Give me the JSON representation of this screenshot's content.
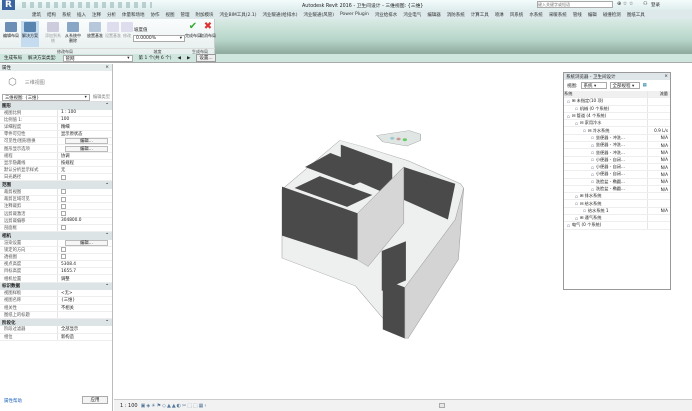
{
  "app": {
    "title": "Autodesk Revit 2016 -   卫生间设计 - 三维视图: {三维}",
    "search_placeholder": "键入关键字或短语",
    "user": "登录"
  },
  "tabs": [
    "建筑",
    "结构",
    "系统",
    "插入",
    "注释",
    "分析",
    "体量和场地",
    "协作",
    "视图",
    "管理",
    "附加模块",
    "鸿业BIM工具(2.1)",
    "鸿业暖通(给排水)",
    "鸿业暖通(风管)",
    "Power Plugin",
    "鸿业给排水",
    "鸿业电气",
    "编辑器",
    "消防系统",
    "计算工具",
    "喷淋",
    "风系统",
    "水系统",
    "采暖系统",
    "管线",
    "编辑",
    "碰撞检测",
    "图纸工具"
  ],
  "ribbon": {
    "buttons": [
      "编辑布局",
      "解决方案",
      "添加到系统",
      "从系统中删除",
      "放置基准",
      "设置基准",
      "修改",
      "修改"
    ],
    "slope_label": "坡度值",
    "slope_value": "0.0000%",
    "finish": "完成布局",
    "cancel": "取消布局",
    "panels": [
      "修改布局",
      "坡度",
      "生成布局"
    ]
  },
  "optbar": {
    "mode": "生成布局",
    "type_label": "解决方案类型:",
    "type_value": "管网",
    "counter": "第 1 个(共 6 个)",
    "prev": "◀",
    "next": "▶",
    "settings": "设置..."
  },
  "props": {
    "title": "属性",
    "type_name": "三维视图",
    "view_selector": "三维视图: {三维}",
    "edit_type": "编辑类型",
    "sections": [
      {
        "name": "图形",
        "rows": [
          [
            "视图比例",
            "1 : 100"
          ],
          [
            "比例值 1:",
            "100"
          ],
          [
            "详细程度",
            "精细"
          ],
          [
            "零件可见性",
            "显示原状态"
          ],
          [
            "可见性/图形替换",
            "编辑..."
          ],
          [
            "图形显示选项",
            "编辑..."
          ],
          [
            "规程",
            "协调"
          ],
          [
            "显示隐藏线",
            "按规程"
          ],
          [
            "默认分析显示样式",
            "无"
          ],
          [
            "日光路径",
            "☐"
          ]
        ]
      },
      {
        "name": "范围",
        "rows": [
          [
            "裁剪视图",
            "☐"
          ],
          [
            "裁剪区域可见",
            "☐"
          ],
          [
            "注释裁剪",
            "☐"
          ],
          [
            "远剪裁激活",
            "☐"
          ],
          [
            "远剪裁偏移",
            "304800.0"
          ],
          [
            "剖面框",
            "☐"
          ]
        ]
      },
      {
        "name": "相机",
        "rows": [
          [
            "渲染设置",
            "编辑..."
          ],
          [
            "锁定的方向",
            "☐"
          ],
          [
            "透视图",
            "☐"
          ],
          [
            "视点高度",
            "5308.4"
          ],
          [
            "目标高度",
            "1655.7"
          ],
          [
            "相机位置",
            "调整"
          ]
        ]
      },
      {
        "name": "标识数据",
        "rows": [
          [
            "视图样板",
            "<无>"
          ],
          [
            "视图名称",
            "{三维}"
          ],
          [
            "相关性",
            "不相关"
          ],
          [
            "图纸上的标题",
            ""
          ]
        ]
      },
      {
        "name": "阶段化",
        "rows": [
          [
            "阶段过滤器",
            "全部显示"
          ],
          [
            "相位",
            "新构造"
          ]
        ]
      }
    ],
    "help": "属性帮助",
    "apply": "应用"
  },
  "sysbrowser": {
    "title": "系统浏览器 - 卫生间设计",
    "view_label": "视图:",
    "view_value": "系统",
    "discipline_value": "全部规程",
    "col_system": "系统",
    "col_flow": "流量",
    "rows": [
      {
        "label": "⊞ 未指定(10 项)",
        "flow": "",
        "lvl": 0
      },
      {
        "label": "机械 (0 个系统)",
        "flow": "",
        "lvl": 1
      },
      {
        "label": "⊟ 管道 (4 个系统)",
        "flow": "",
        "lvl": 0
      },
      {
        "label": "⊟ 家用冷水",
        "flow": "",
        "lvl": 1
      },
      {
        "label": "⊟ 冷水系统",
        "flow": "0.9 L/s",
        "lvl": 2
      },
      {
        "label": "坐便器 - 冲洗...",
        "flow": "N/A",
        "lvl": 3
      },
      {
        "label": "坐便器 - 冲洗...",
        "flow": "N/A",
        "lvl": 3
      },
      {
        "label": "坐便器 - 冲洗...",
        "flow": "N/A",
        "lvl": 3
      },
      {
        "label": "小便器 - 自闭...",
        "flow": "N/A",
        "lvl": 3
      },
      {
        "label": "小便器 - 自闭...",
        "flow": "N/A",
        "lvl": 3
      },
      {
        "label": "小便器 - 自闭...",
        "flow": "N/A",
        "lvl": 3
      },
      {
        "label": "洗脸盆 - 椭圆...",
        "flow": "N/A",
        "lvl": 3
      },
      {
        "label": "洗脸盆 - 椭圆...",
        "flow": "N/A",
        "lvl": 3
      },
      {
        "label": "⊞ 排水系统",
        "flow": "",
        "lvl": 1
      },
      {
        "label": "⊟ 给水系统",
        "flow": "",
        "lvl": 1
      },
      {
        "label": "给水系统 1",
        "flow": "N/A",
        "lvl": 2
      },
      {
        "label": "⊞ 通气系统",
        "flow": "",
        "lvl": 1
      },
      {
        "label": "电气 (0 个系统)",
        "flow": "",
        "lvl": 0
      }
    ]
  },
  "status": {
    "scale": "1 : 100"
  }
}
